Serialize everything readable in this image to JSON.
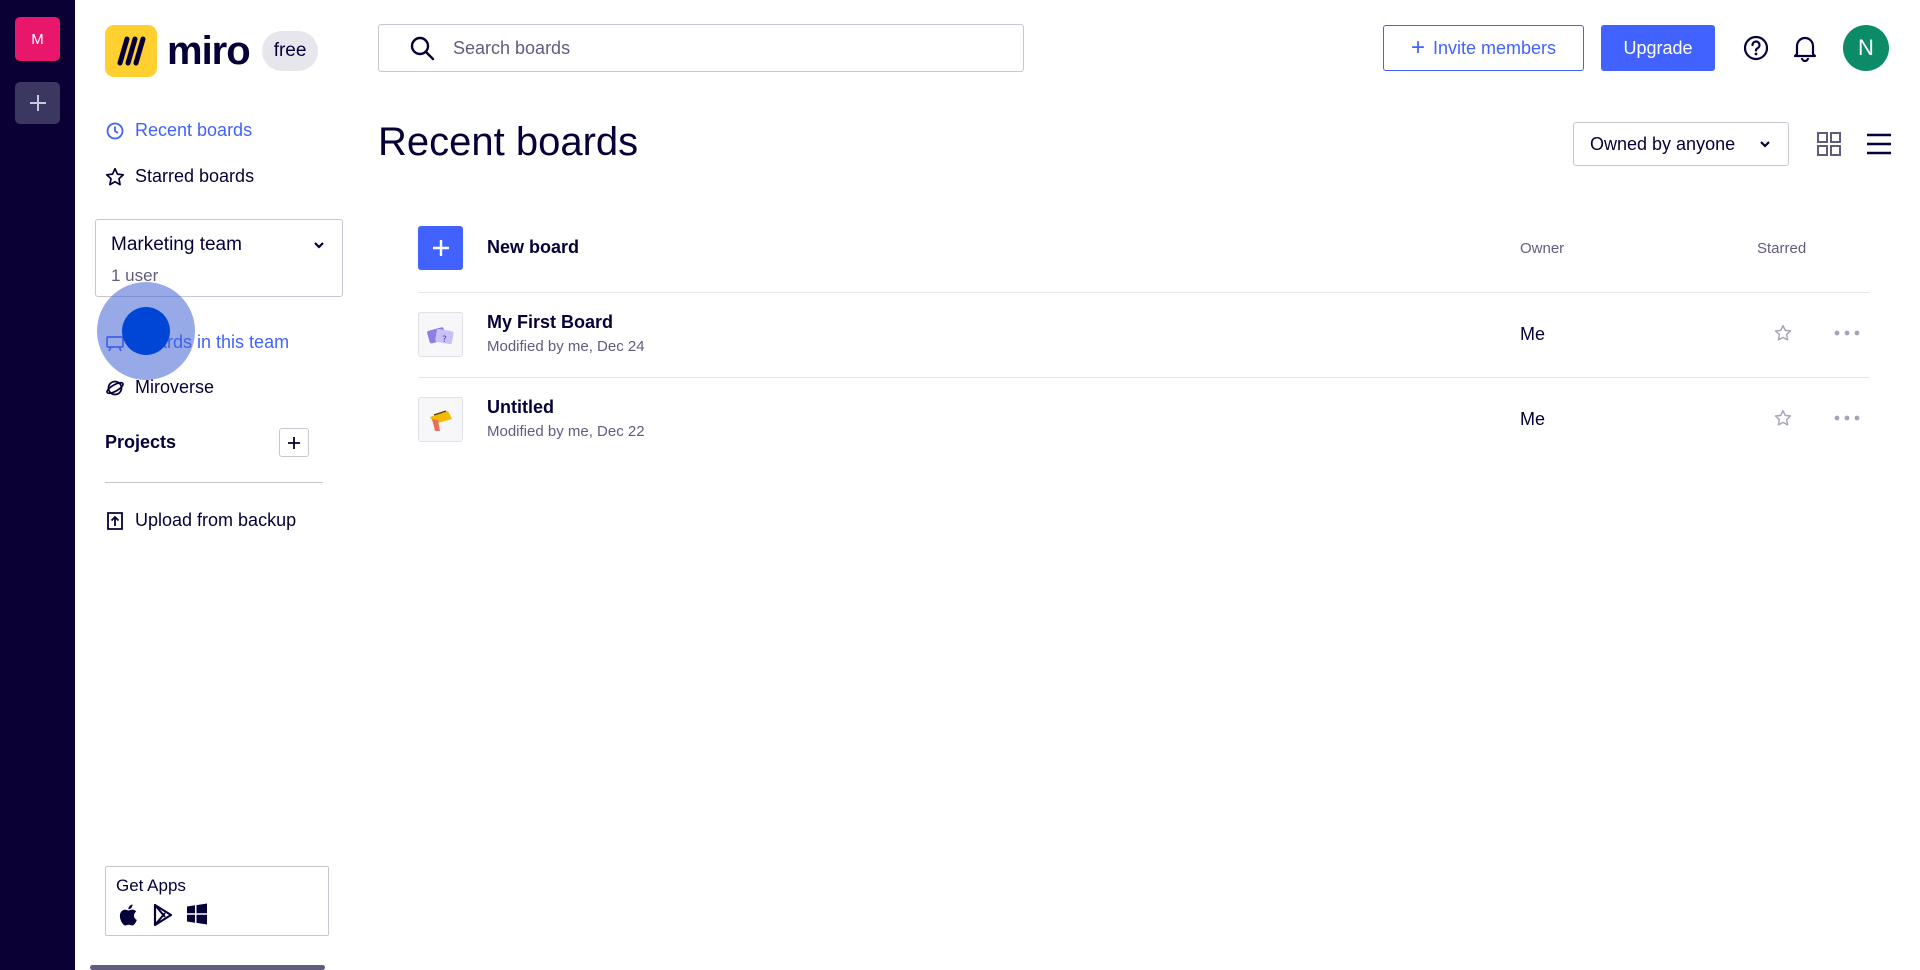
{
  "rail": {
    "team_initial": "M"
  },
  "logo": {
    "text": "miro",
    "plan_badge": "free"
  },
  "sidebar": {
    "nav": [
      {
        "label": "Recent boards",
        "icon": "clock-icon",
        "active": true
      },
      {
        "label": "Starred boards",
        "icon": "star-icon",
        "active": false
      }
    ],
    "team": {
      "name": "Marketing team",
      "users": "1 user"
    },
    "team_nav": [
      {
        "label": "Boards in this team",
        "icon": "board-icon",
        "active": true
      },
      {
        "label": "Miroverse",
        "icon": "miroverse-icon",
        "active": false
      }
    ],
    "projects_title": "Projects",
    "upload_label": "Upload from backup",
    "get_apps": {
      "title": "Get Apps",
      "platforms": [
        "apple-icon",
        "google-play-icon",
        "windows-icon"
      ]
    }
  },
  "header": {
    "search_placeholder": "Search boards",
    "invite_label": "Invite members",
    "upgrade_label": "Upgrade",
    "avatar_initial": "N"
  },
  "main": {
    "title": "Recent boards",
    "owner_filter": "Owned by anyone",
    "new_board_label": "New board",
    "columns": {
      "owner": "Owner",
      "starred": "Starred"
    },
    "boards": [
      {
        "name": "My First Board",
        "meta": "Modified by me, Dec 24",
        "owner": "Me",
        "starred": false
      },
      {
        "name": "Untitled",
        "meta": "Modified by me, Dec 22",
        "owner": "Me",
        "starred": false
      }
    ]
  },
  "colors": {
    "accent": "#4262ff",
    "rail": "#0a0033",
    "team_tile": "#e8176c",
    "logo_yellow": "#ffd02f",
    "avatar": "#0c8b68",
    "text": "#050038"
  }
}
